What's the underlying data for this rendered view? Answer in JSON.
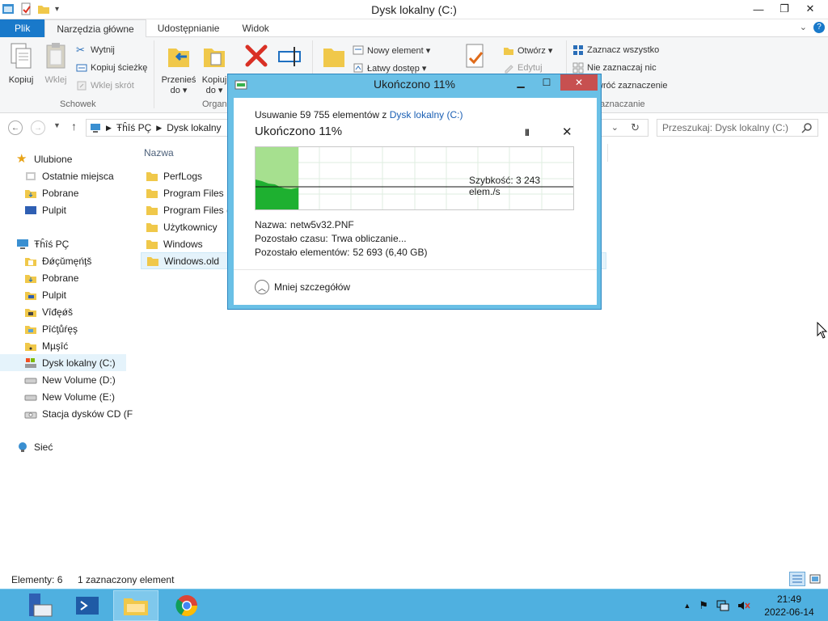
{
  "window": {
    "title": "Dysk lokalny (C:)",
    "controls": {
      "minimize": "—",
      "maximize": "❐",
      "close": "✕"
    }
  },
  "ribbon": {
    "tabs": [
      {
        "label": "Plik"
      },
      {
        "label": "Narzędzia główne"
      },
      {
        "label": "Udostępnianie"
      },
      {
        "label": "Widok"
      }
    ],
    "clipboard": {
      "copy": "Kopiuj",
      "paste": "Wklej",
      "cut": "Wytnij",
      "copy_path": "Kopiuj ścieżkę",
      "paste_shortcut": "Wklej skrót",
      "group": "Schowek"
    },
    "organize": {
      "move_to": "Przenieś",
      "move_to_line2": "do ▾",
      "copy_to": "Kopiuj",
      "copy_to_line2": "do ▾",
      "group": "Organ"
    },
    "new": {
      "new_item": "Nowy element ▾",
      "easy_access": "Łatwy dostęp ▾"
    },
    "open": {
      "open": "Otwórz ▾",
      "edit": "Edytuj"
    },
    "select": {
      "select_all": "Zaznacz wszystko",
      "select_none": "Nie zaznaczaj nic",
      "invert": "wróć zaznaczenie",
      "group": "aznaczanie"
    }
  },
  "address": {
    "path": [
      "Ŧĥîś PÇ",
      "Dysk lokalny"
    ],
    "search_placeholder": "Przeszukaj: Dysk lokalny (C:)"
  },
  "nav": {
    "favorites_label": "Ulubione",
    "favorites": [
      "Ostatnie miejsca",
      "Pobrane",
      "Pulpit"
    ],
    "pc_label": "Ŧĥîś PÇ",
    "pc": [
      "Ðǿçŭmęńţš",
      "Pobrane",
      "Pulpit",
      "Vîđęǿš",
      "Pîćţůŕęş",
      "Mµşîć",
      "Dysk lokalny (C:)",
      "New Volume (D:)",
      "New Volume (E:)",
      "Stacja dysków CD (F"
    ],
    "network_label": "Sieć"
  },
  "files": {
    "column_name": "Nazwa",
    "rows": [
      "PerfLogs",
      "Program Files",
      "Program Files (x",
      "Użytkownicy",
      "Windows",
      "Windows.old"
    ]
  },
  "status": {
    "items": "Elementy: 6",
    "selected": "1 zaznaczony element"
  },
  "taskbar": {
    "time": "21:49",
    "date": "2022-06-14"
  },
  "dialog": {
    "title": "Ukończono 11%",
    "subtitle_prefix": "Usuwanie 59 755 elementów z ",
    "subtitle_link": "Dysk lokalny (C:)",
    "heading": "Ukończono 11%",
    "pause": "II",
    "cancel": "✕",
    "speed": "Szybkość: 3 243 elem./s",
    "progress_fraction": 0.11,
    "name_label": "Nazwa:",
    "name_value": "netw5v32.PNF",
    "time_label": "Pozostało czasu:",
    "time_value": "Trwa obliczanie...",
    "items_label": "Pozostało elementów:",
    "items_value": "52 693 (6,40 GB)",
    "fewer_details": "Mniej szczegółów",
    "colors": {
      "graph_fill": "#a6e08f",
      "graph_dark": "#1eb030",
      "frame": "#6ac0e6"
    }
  }
}
